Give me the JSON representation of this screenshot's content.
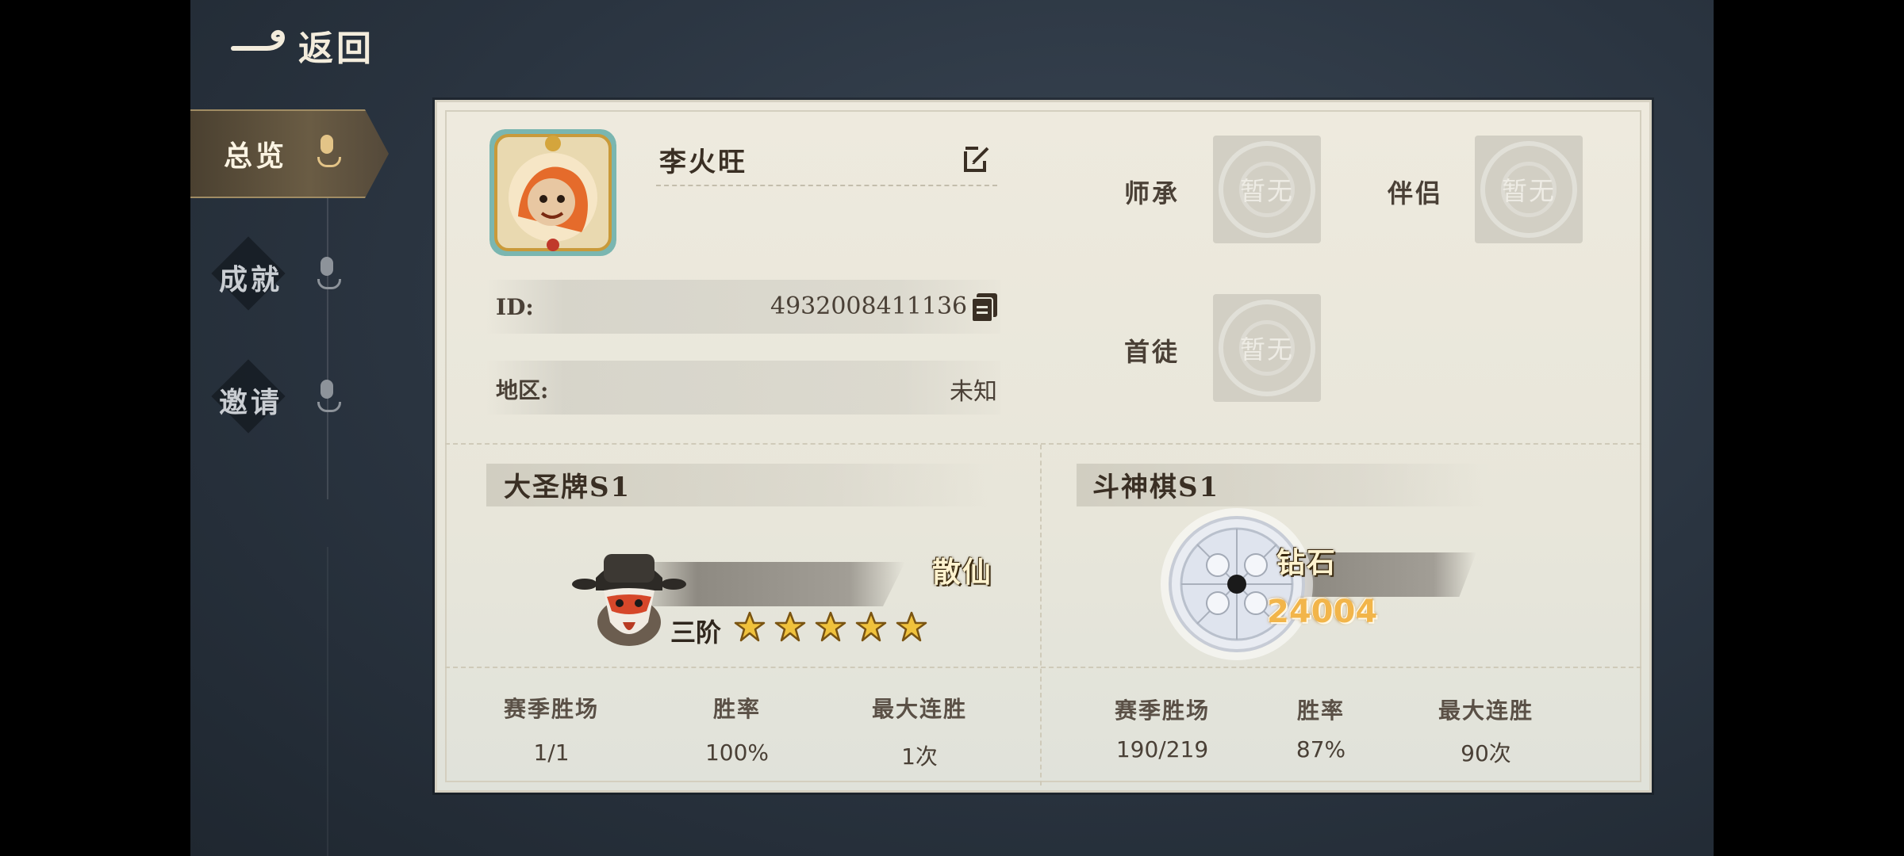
{
  "header": {
    "back_label": "返回"
  },
  "sidebar": {
    "items": [
      {
        "label": "总览",
        "active": true
      },
      {
        "label": "成就",
        "active": false
      },
      {
        "label": "邀请",
        "active": false
      }
    ]
  },
  "profile": {
    "name": "李火旺",
    "id_label": "ID:",
    "id_value": "4932008411136",
    "region_label": "地区:",
    "region_value": "未知"
  },
  "relations": [
    {
      "label": "师承",
      "value": "暂无"
    },
    {
      "label": "伴侣",
      "value": "暂无"
    },
    {
      "label": "首徒",
      "value": "暂无"
    }
  ],
  "seasons": [
    {
      "title": "大圣牌S1",
      "rank": "散仙",
      "tier": "三阶",
      "stars": 5,
      "stats": [
        {
          "label": "赛季胜场",
          "value": "1/1"
        },
        {
          "label": "胜率",
          "value": "100%"
        },
        {
          "label": "最大连胜",
          "value": "1次"
        }
      ]
    },
    {
      "title": "斗神棋S1",
      "rank": "钻石",
      "score": "24004",
      "stats": [
        {
          "label": "赛季胜场",
          "value": "190/219"
        },
        {
          "label": "胜率",
          "value": "87%"
        },
        {
          "label": "最大连胜",
          "value": "90次"
        }
      ]
    }
  ],
  "colors": {
    "accent_gold": "#f2b54a",
    "card_bg": "#eeeade",
    "backdrop": "#2a3440"
  }
}
